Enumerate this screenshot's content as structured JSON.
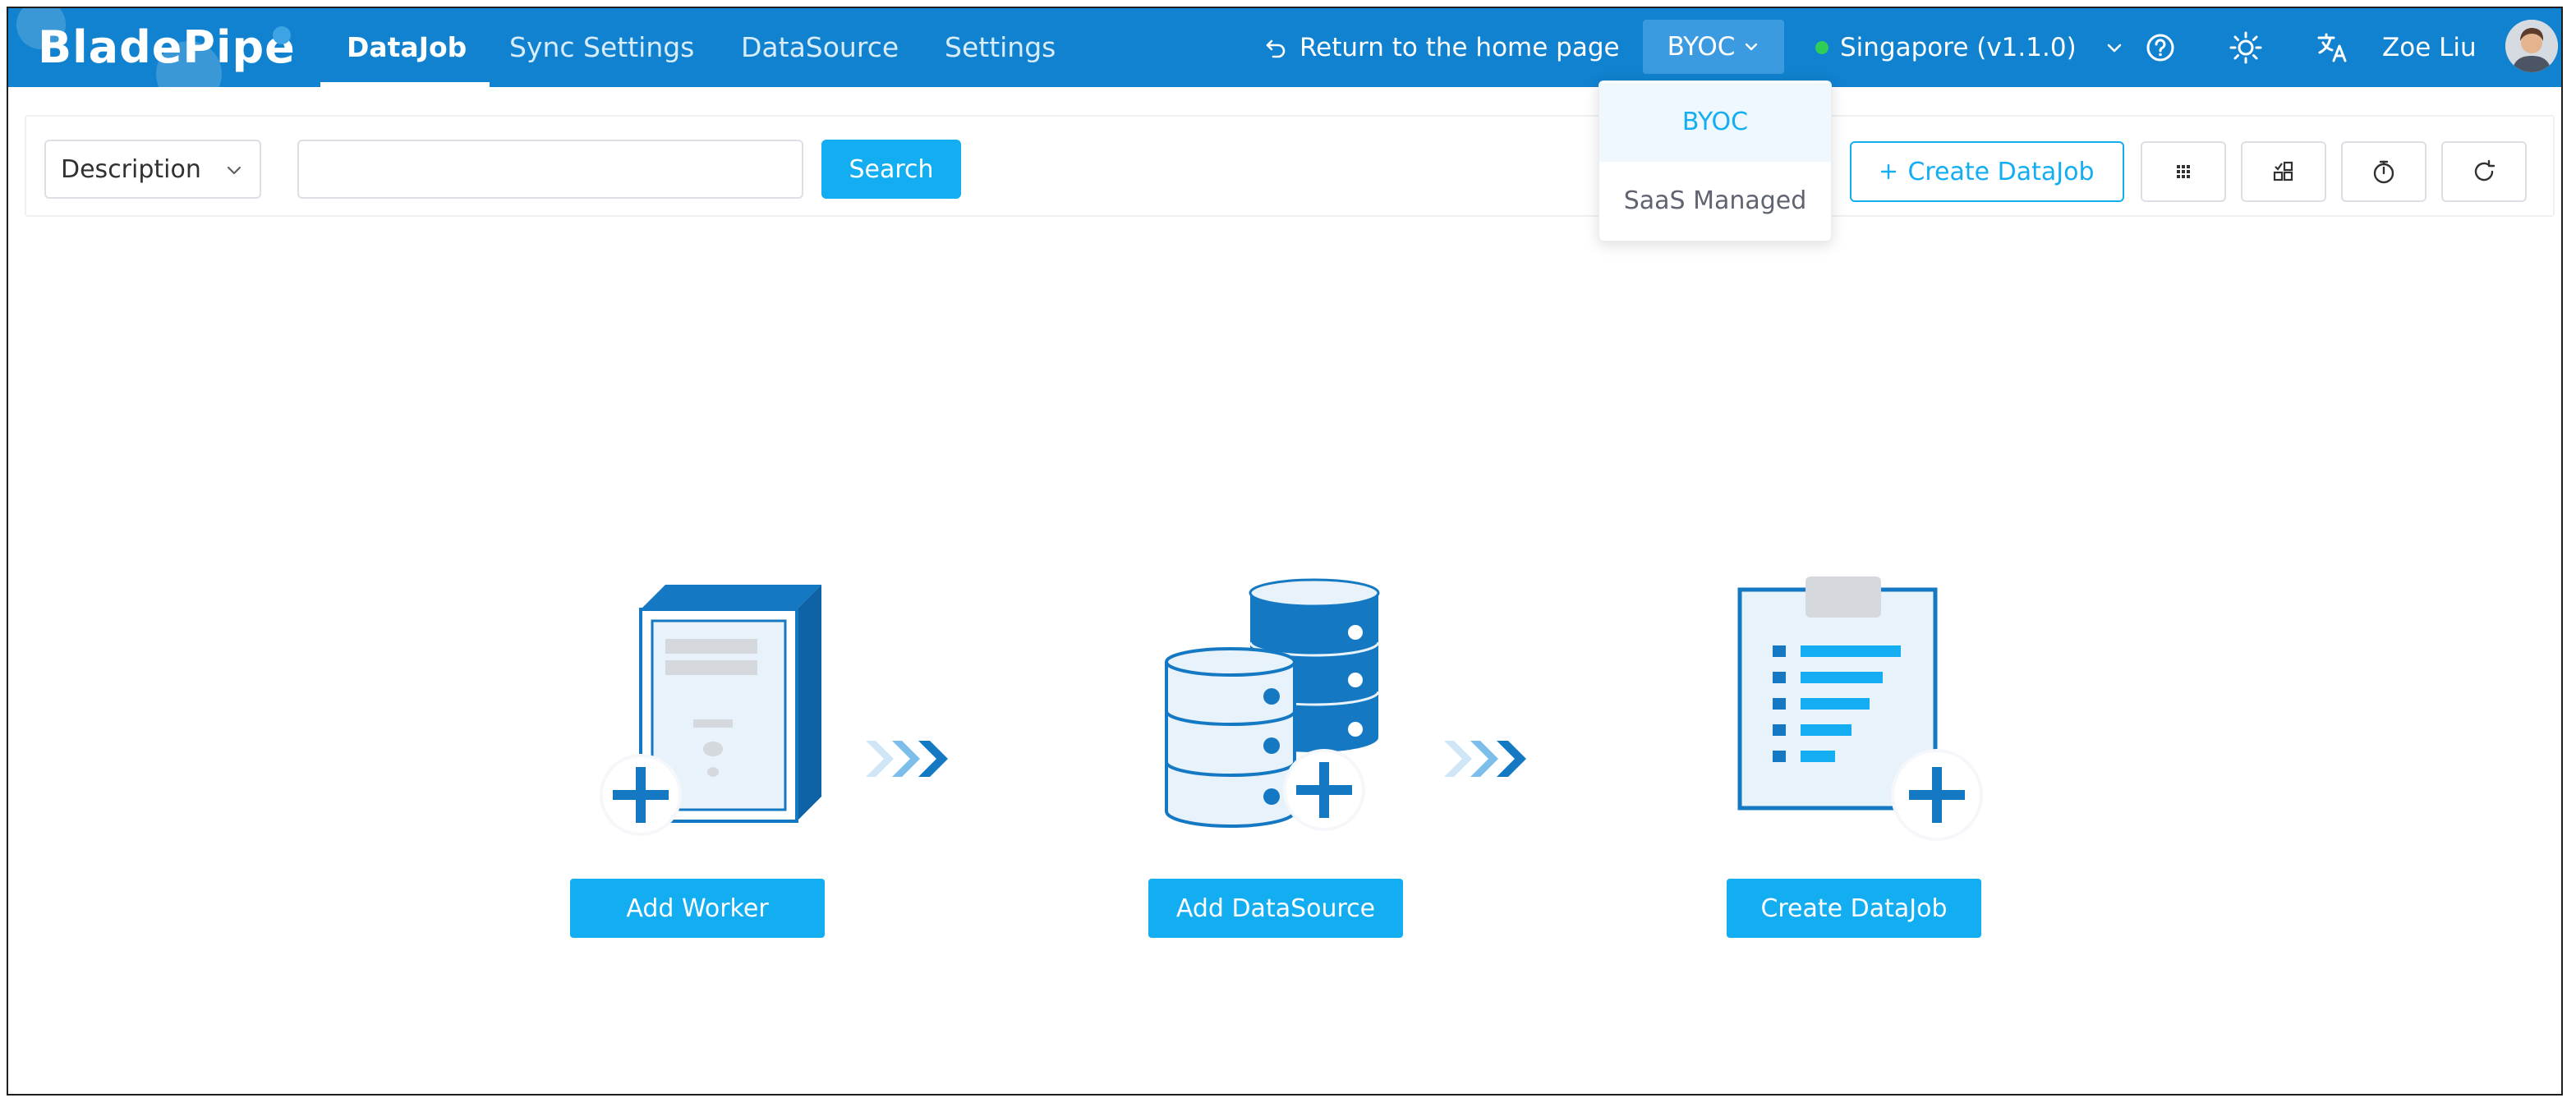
{
  "app": {
    "logo_text": "BladePipe",
    "nav_tabs": [
      {
        "label": "DataJob",
        "active": true
      },
      {
        "label": "Sync Settings",
        "active": false
      },
      {
        "label": "DataSource",
        "active": false
      },
      {
        "label": "Settings",
        "active": false
      }
    ],
    "return_label": "Return to the home page",
    "deploy_mode": "BYOC",
    "region_label": "Singapore (v1.1.0)",
    "region_status_color": "#2fcf57",
    "user_name": "Zoe Liu",
    "brand_color": "#1082cf",
    "accent_color": "#13adf2"
  },
  "toolbar": {
    "filter_select_value": "Description",
    "search_value": "",
    "search_label": "Search",
    "create_label": "Create DataJob",
    "icons": [
      "grid-icon",
      "layout-icon",
      "timer-icon",
      "refresh-icon"
    ]
  },
  "dropdown": {
    "items": [
      {
        "label": "BYOC",
        "selected": true
      },
      {
        "label": "SaaS Managed",
        "selected": false
      }
    ]
  },
  "steps": [
    {
      "label": "Add Worker",
      "icon": "server-icon"
    },
    {
      "label": "Add DataSource",
      "icon": "database-icon"
    },
    {
      "label": "Create DataJob",
      "icon": "clipboard-icon"
    }
  ]
}
